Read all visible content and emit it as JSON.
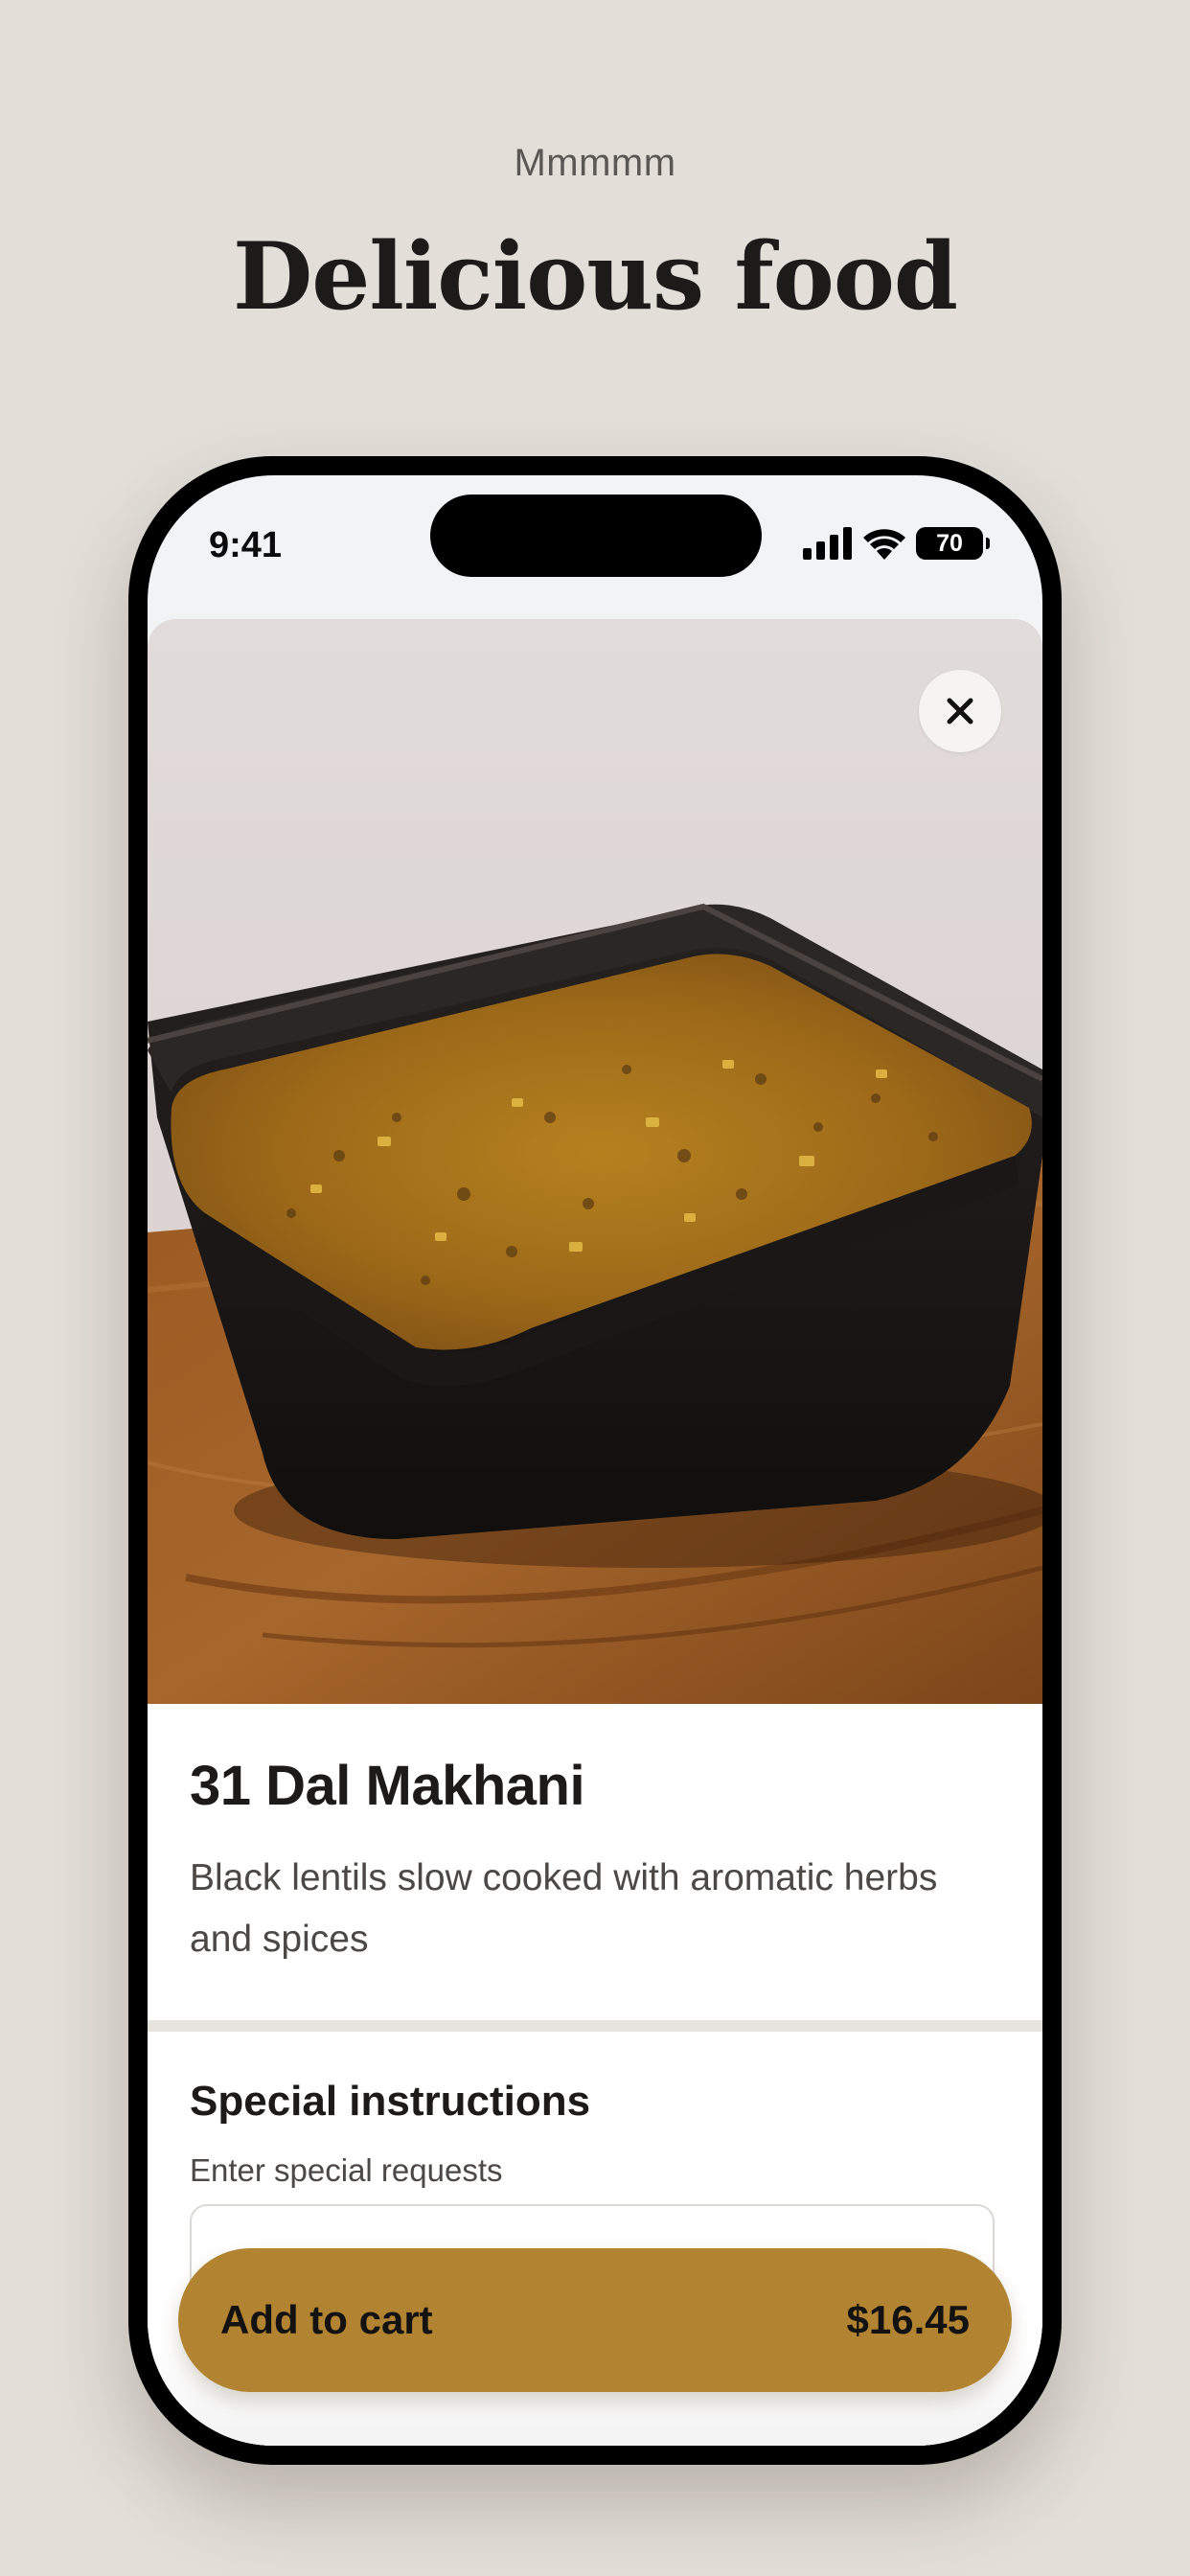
{
  "header": {
    "eyebrow": "Mmmmm",
    "title": "Delicious food"
  },
  "status_bar": {
    "time": "9:41",
    "battery": "70",
    "icons": [
      "cellular-signal-icon",
      "wifi-icon",
      "battery-icon"
    ]
  },
  "product": {
    "image_alt": "dal-makhani-photo",
    "name": "31 Dal Makhani",
    "description": "Black lentils slow cooked with aromatic herbs and spices"
  },
  "special_instructions": {
    "title": "Special instructions",
    "subtitle": "Enter special requests",
    "value": ""
  },
  "cart_button": {
    "label": "Add to cart",
    "price": "$16.45"
  },
  "colors": {
    "background": "#e3ded8",
    "accent": "#b28432",
    "text": "#1c1b1a"
  }
}
